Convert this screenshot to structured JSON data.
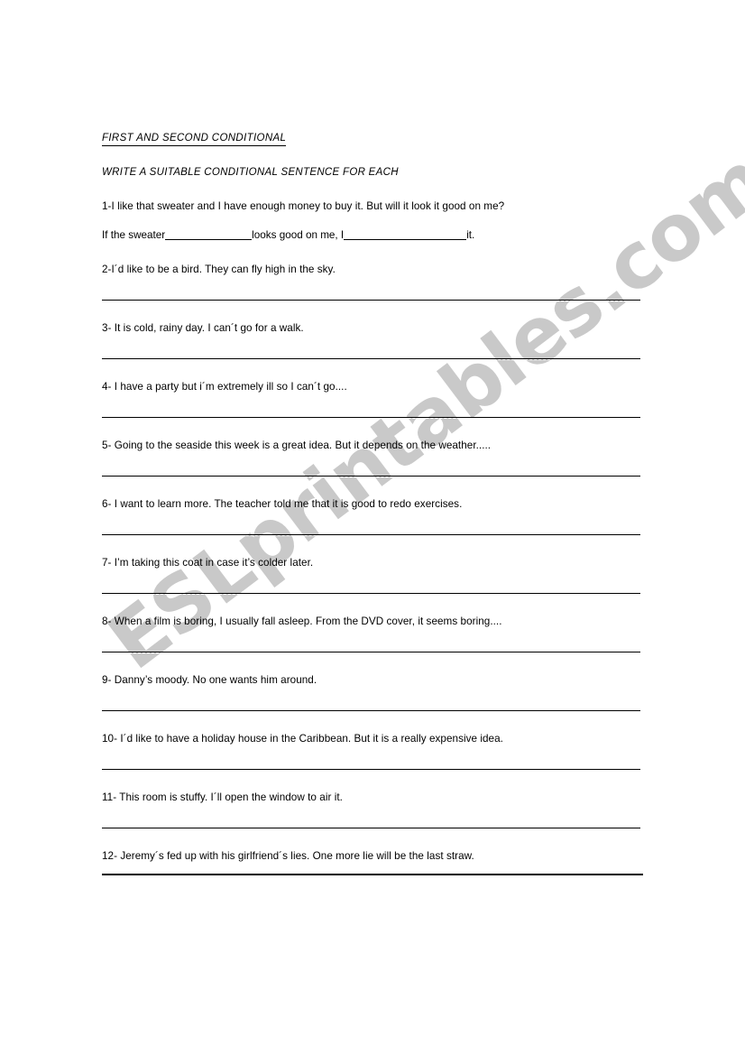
{
  "document": {
    "title": "FIRST AND SECOND CONDITIONAL",
    "instruction": "WRITE A SUITABLE  CONDITIONAL SENTENCE FOR EACH",
    "watermark": "ESLprintables.com",
    "watermark_color": "#c9c9c9"
  },
  "items": [
    {
      "number": "1",
      "prompt": "1-I like that sweater and I have enough money to buy it. But will it look it good on me?",
      "answer_type": "fill-in",
      "fill_parts": {
        "before": "If the sweater",
        "middle": "looks good on me, I",
        "after": "it."
      }
    },
    {
      "number": "2",
      "prompt": "2-I´d like to be a bird. They can fly high in the sky.",
      "answer_type": "blank-line"
    },
    {
      "number": "3",
      "prompt": "3- It is cold, rainy day. I can´t go for a walk.",
      "answer_type": "blank-line"
    },
    {
      "number": "4",
      "prompt": "4- I have a party but i´m  extremely ill so I can´t go....",
      "answer_type": "blank-line"
    },
    {
      "number": "5",
      "prompt": "5-  Going to the seaside this week is a great idea. But it depends on the weather.....",
      "answer_type": "blank-line"
    },
    {
      "number": "6",
      "prompt": "6- I want to learn more.  The teacher told me that it is good to redo exercises.",
      "answer_type": "blank-line"
    },
    {
      "number": "7",
      "prompt": "7- I’m taking this coat in case it’s colder later.",
      "answer_type": "blank-line"
    },
    {
      "number": "8",
      "prompt": "8- When a film is boring, I usually fall asleep. From the DVD cover,  it seems boring....",
      "answer_type": "blank-line"
    },
    {
      "number": "9",
      "prompt": "9- Danny’s moody. No one wants him around.",
      "answer_type": "blank-line"
    },
    {
      "number": "10",
      "prompt": "10-  I´d like to have a holiday house in the Caribbean. But it is a really expensive idea.",
      "answer_type": "blank-line"
    },
    {
      "number": "11",
      "prompt": "11- This room is stuffy. I´ll open the window to air it.",
      "answer_type": "blank-line"
    },
    {
      "number": "12",
      "prompt": "12- Jeremy´s fed up with his girlfriend´s lies. One more lie will be the last straw.",
      "answer_type": "bottom-rule"
    }
  ]
}
